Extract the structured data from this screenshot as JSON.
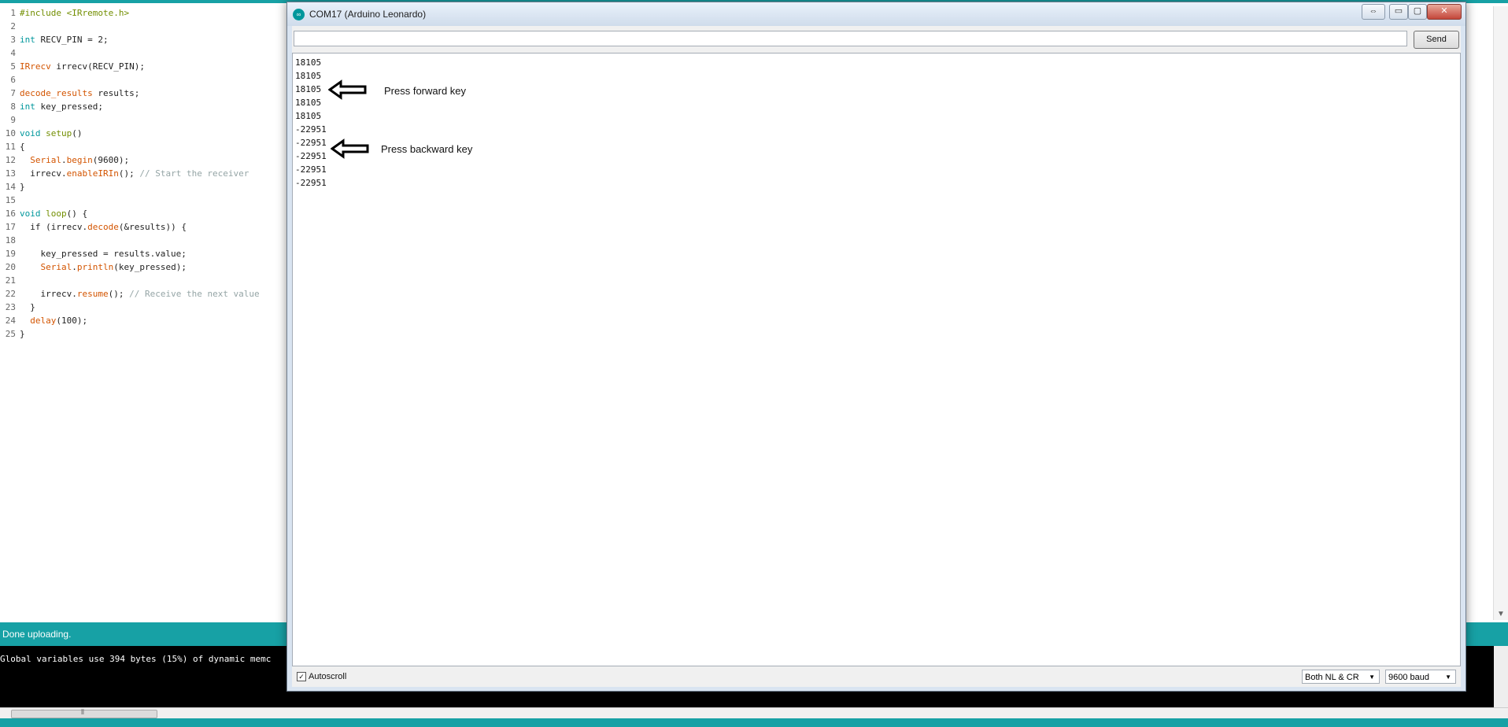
{
  "code": {
    "line_numbers": [
      "1",
      "2",
      "3",
      "4",
      "5",
      "6",
      "7",
      "8",
      "9",
      "10",
      "11",
      "12",
      "13",
      "14",
      "15",
      "16",
      "17",
      "18",
      "19",
      "20",
      "21",
      "22",
      "23",
      "24",
      "25"
    ],
    "lines": [
      [
        {
          "t": "#include <IRremote.h>",
          "c": "kw-ctl"
        }
      ],
      [],
      [
        {
          "t": "int",
          "c": "kw-type"
        },
        {
          "t": " RECV_PIN = 2;",
          "c": ""
        }
      ],
      [],
      [
        {
          "t": "IRrecv",
          "c": "kw-cls"
        },
        {
          "t": " irrecv(RECV_PIN);",
          "c": ""
        }
      ],
      [],
      [
        {
          "t": "decode_results",
          "c": "kw-cls"
        },
        {
          "t": " results;",
          "c": ""
        }
      ],
      [
        {
          "t": "int",
          "c": "kw-type"
        },
        {
          "t": " key_pressed;",
          "c": ""
        }
      ],
      [],
      [
        {
          "t": "void",
          "c": "kw-type"
        },
        {
          "t": " ",
          "c": ""
        },
        {
          "t": "setup",
          "c": "kw-ctl"
        },
        {
          "t": "()",
          "c": ""
        }
      ],
      [
        {
          "t": "{",
          "c": ""
        }
      ],
      [
        {
          "t": "  ",
          "c": ""
        },
        {
          "t": "Serial",
          "c": "kw-fn"
        },
        {
          "t": ".",
          "c": ""
        },
        {
          "t": "begin",
          "c": "kw-fn"
        },
        {
          "t": "(9600);",
          "c": ""
        }
      ],
      [
        {
          "t": "  irrecv.",
          "c": ""
        },
        {
          "t": "enableIRIn",
          "c": "kw-fn"
        },
        {
          "t": "(); ",
          "c": ""
        },
        {
          "t": "// Start the receiver",
          "c": "cm"
        }
      ],
      [
        {
          "t": "}",
          "c": ""
        }
      ],
      [],
      [
        {
          "t": "void",
          "c": "kw-type"
        },
        {
          "t": " ",
          "c": ""
        },
        {
          "t": "loop",
          "c": "kw-ctl"
        },
        {
          "t": "() {",
          "c": ""
        }
      ],
      [
        {
          "t": "  if (irrecv.",
          "c": ""
        },
        {
          "t": "decode",
          "c": "kw-fn"
        },
        {
          "t": "(&results)) {",
          "c": ""
        }
      ],
      [],
      [
        {
          "t": "    key_pressed = results.value;",
          "c": ""
        }
      ],
      [
        {
          "t": "    ",
          "c": ""
        },
        {
          "t": "Serial",
          "c": "kw-fn"
        },
        {
          "t": ".",
          "c": ""
        },
        {
          "t": "println",
          "c": "kw-fn"
        },
        {
          "t": "(key_pressed);",
          "c": ""
        }
      ],
      [],
      [
        {
          "t": "    irrecv.",
          "c": ""
        },
        {
          "t": "resume",
          "c": "kw-fn"
        },
        {
          "t": "(); ",
          "c": ""
        },
        {
          "t": "// Receive the next value",
          "c": "cm"
        }
      ],
      [
        {
          "t": "  }",
          "c": ""
        }
      ],
      [
        {
          "t": "  ",
          "c": ""
        },
        {
          "t": "delay",
          "c": "kw-fn"
        },
        {
          "t": "(100);",
          "c": ""
        }
      ],
      [
        {
          "t": "}",
          "c": ""
        }
      ]
    ]
  },
  "status": {
    "text": "Done uploading."
  },
  "console": {
    "text": "Global variables use 394 bytes (15%) of dynamic memc"
  },
  "monitor": {
    "title": "COM17 (Arduino Leonardo)",
    "app_icon": "arduino-icon",
    "buttons": {
      "restore": "⇔",
      "minimize": "▭",
      "maximize": "▢",
      "close": "✕"
    },
    "send_input_value": "",
    "send_label": "Send",
    "output_lines": [
      "18105",
      "18105",
      "18105",
      "18105",
      "18105",
      "-22951",
      "-22951",
      "-22951",
      "-22951",
      "-22951"
    ],
    "annotations": {
      "forward": "Press forward key",
      "backward": "Press backward key"
    },
    "autoscroll_label": "Autoscroll",
    "autoscroll_checked": "✓",
    "line_ending": "Both NL & CR",
    "baud": "9600 baud"
  },
  "colors": {
    "accent": "#17a1a5",
    "console_bg": "#000000"
  }
}
